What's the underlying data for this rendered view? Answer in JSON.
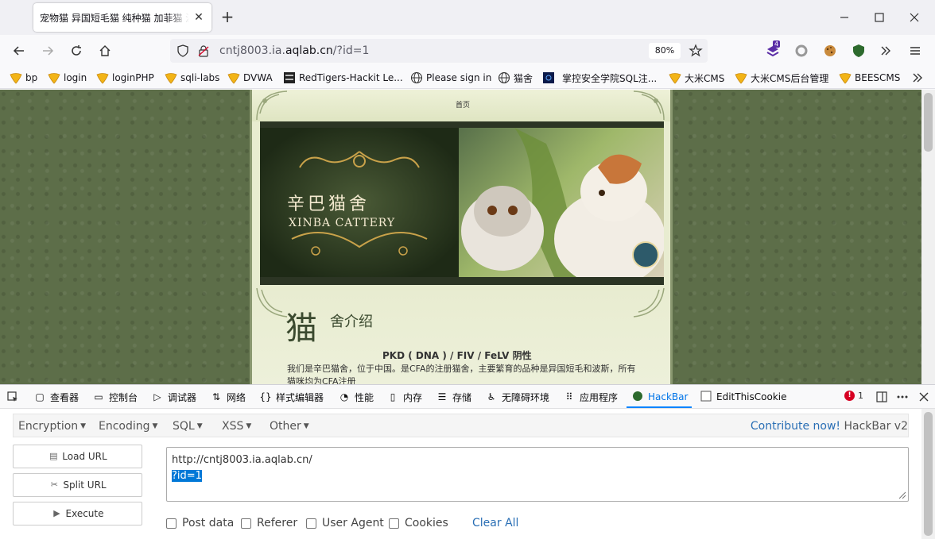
{
  "browser": {
    "tab_title": "宠物猫 异国短毛猫 纯种猫 加菲猫 波",
    "url_prefix": "cntj8003.ia.",
    "url_host": "aqlab.cn",
    "url_path": "/?id=1",
    "zoom": "80%",
    "extension_badge": "4"
  },
  "bookmarks": [
    {
      "label": "bp",
      "icon": "shield-icon"
    },
    {
      "label": "login",
      "icon": "shield-icon"
    },
    {
      "label": "loginPHP",
      "icon": "shield-icon"
    },
    {
      "label": "sqli-labs",
      "icon": "shield-icon"
    },
    {
      "label": "DVWA",
      "icon": "shield-icon"
    },
    {
      "label": "RedTigers-Hackit Le...",
      "icon": "hackit-icon"
    },
    {
      "label": "Please sign in",
      "icon": "globe-icon"
    },
    {
      "label": "猫舍",
      "icon": "globe-icon"
    },
    {
      "label": "掌控安全学院SQL注...",
      "icon": "dark-site-icon"
    },
    {
      "label": "大米CMS",
      "icon": "shield-icon"
    },
    {
      "label": "大米CMS后台管理",
      "icon": "shield-icon"
    },
    {
      "label": "BEESCMS",
      "icon": "shield-icon"
    }
  ],
  "site": {
    "nav_home": "首页",
    "banner_cn": "辛巴猫舍",
    "banner_en": "XINBA CATTERY",
    "heading_big": "猫",
    "heading_small": "舍介绍",
    "pkd": "PKD ( DNA ) / FIV / FeLV 阴性",
    "intro": "我们是辛巴猫舍，位于中国。是CFA的注册猫舍，主要繁育的品种是异国短毛和波斯，所有猫咪均为CFA注册"
  },
  "devtools": {
    "tabs": [
      {
        "label": "查看器",
        "icon": "inspector-icon"
      },
      {
        "label": "控制台",
        "icon": "console-icon"
      },
      {
        "label": "调试器",
        "icon": "debugger-icon"
      },
      {
        "label": "网络",
        "icon": "network-icon"
      },
      {
        "label": "样式编辑器",
        "icon": "style-editor-icon"
      },
      {
        "label": "性能",
        "icon": "performance-icon"
      },
      {
        "label": "内存",
        "icon": "memory-icon"
      },
      {
        "label": "存储",
        "icon": "storage-icon"
      },
      {
        "label": "无障碍环境",
        "icon": "accessibility-icon"
      },
      {
        "label": "应用程序",
        "icon": "application-icon"
      },
      {
        "label": "HackBar",
        "icon": "hackbar-icon"
      },
      {
        "label": "EditThisCookie",
        "icon": "cookie-icon"
      }
    ],
    "active_tab": "HackBar",
    "error_count": "1"
  },
  "hackbar": {
    "menus": [
      "Encryption",
      "Encoding",
      "SQL",
      "XSS",
      "Other"
    ],
    "contribute_link": "Contribute now!",
    "version": "HackBar v2",
    "buttons": {
      "load": "Load URL",
      "split": "Split URL",
      "execute": "Execute"
    },
    "url_line1": "http://cntj8003.ia.aqlab.cn/",
    "url_line2": "?id=1",
    "checkboxes": [
      "Post data",
      "Referer",
      "User Agent",
      "Cookies"
    ],
    "clear_all": "Clear All"
  },
  "colors": {
    "accent": "#0a84ff",
    "link": "#2a6fb5",
    "page_bg": "#5d6e49",
    "error": "#d70022"
  }
}
